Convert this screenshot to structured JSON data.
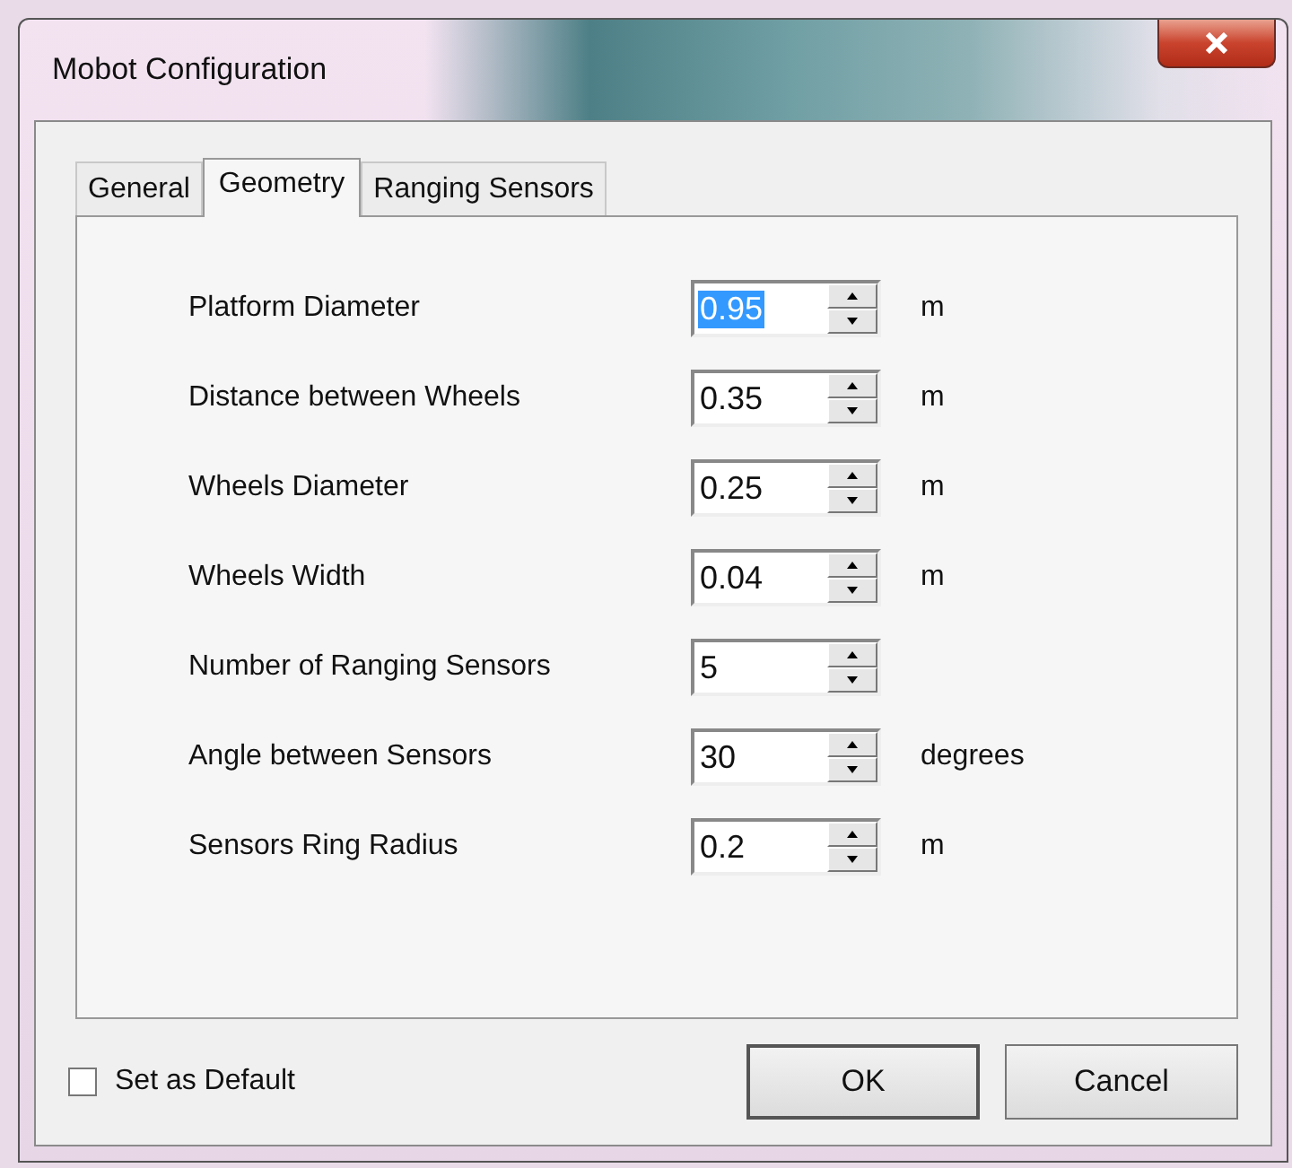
{
  "window": {
    "title": "Mobot Configuration"
  },
  "tabs": [
    {
      "label": "General",
      "selected": false
    },
    {
      "label": "Geometry",
      "selected": true
    },
    {
      "label": "Ranging Sensors",
      "selected": false
    }
  ],
  "fields": [
    {
      "label": "Platform Diameter",
      "value": "0.95",
      "unit": "m",
      "selected": true
    },
    {
      "label": "Distance between Wheels",
      "value": "0.35",
      "unit": "m",
      "selected": false
    },
    {
      "label": "Wheels Diameter",
      "value": "0.25",
      "unit": "m",
      "selected": false
    },
    {
      "label": "Wheels Width",
      "value": "0.04",
      "unit": "m",
      "selected": false
    },
    {
      "label": "Number of Ranging Sensors",
      "value": "5",
      "selected": false
    },
    {
      "label": "Angle between Sensors",
      "value": "30",
      "unit": "degrees",
      "selected": false
    },
    {
      "label": "Sensors Ring Radius",
      "value": "0.2",
      "unit": "m",
      "selected": false
    }
  ],
  "set_default": {
    "label": "Set as Default",
    "checked": false
  },
  "buttons": [
    "OK",
    "Cancel"
  ]
}
